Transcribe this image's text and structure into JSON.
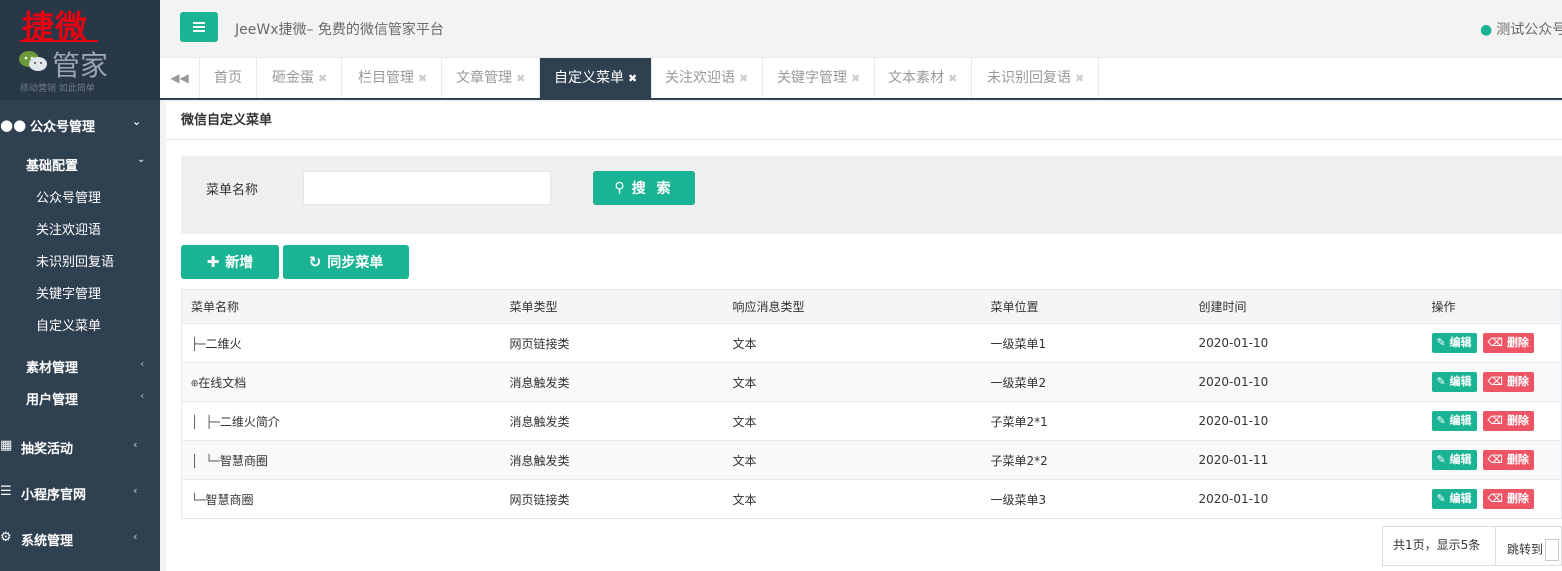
{
  "logo": {
    "main": "捷微",
    "sub": "管家",
    "slogan": "移动营销 如此简单"
  },
  "sidebar": {
    "top": {
      "label": "公众号管理"
    },
    "group": {
      "label": "基础配置"
    },
    "items": [
      "公众号管理",
      "关注欢迎语",
      "未识别回复语",
      "关键字管理",
      "自定义菜单"
    ],
    "sub_sections": [
      "素材管理",
      "用户管理"
    ],
    "sections": [
      "抽奖活动",
      "小程序官网",
      "系统管理"
    ]
  },
  "header": {
    "title": "JeeWx捷微– 免费的微信管家平台",
    "account": "测试公众号"
  },
  "tabs": [
    {
      "label": "首页",
      "closable": false
    },
    {
      "label": "砸金蛋",
      "closable": true
    },
    {
      "label": "栏目管理",
      "closable": true
    },
    {
      "label": "文章管理",
      "closable": true
    },
    {
      "label": "自定义菜单",
      "closable": true,
      "active": true
    },
    {
      "label": "关注欢迎语",
      "closable": true
    },
    {
      "label": "关键字管理",
      "closable": true
    },
    {
      "label": "文本素材",
      "closable": true
    },
    {
      "label": "未识别回复语",
      "closable": true
    }
  ],
  "panel": {
    "title": "微信自定义菜单"
  },
  "search": {
    "label": "菜单名称",
    "value": "",
    "button": "搜 索"
  },
  "actions": {
    "add": "新增",
    "sync": "同步菜单"
  },
  "table": {
    "headers": [
      "菜单名称",
      "菜单类型",
      "响应消息类型",
      "菜单位置",
      "创建时间",
      "操作"
    ],
    "rows": [
      {
        "tree": "├─",
        "name": "二维火",
        "type": "网页链接类",
        "msg": "文本",
        "pos": "一级菜单1",
        "date": "2020-01-10"
      },
      {
        "tree": "⊕",
        "name": "在线文档",
        "type": "消息触发类",
        "msg": "文本",
        "pos": "一级菜单2",
        "date": "2020-01-10"
      },
      {
        "tree": "│ ├─",
        "name": "二维火简介",
        "type": "消息触发类",
        "msg": "文本",
        "pos": "子菜单2*1",
        "date": "2020-01-10"
      },
      {
        "tree": "│ └─",
        "name": "智慧商圈",
        "type": "消息触发类",
        "msg": "文本",
        "pos": "子菜单2*2",
        "date": "2020-01-11"
      },
      {
        "tree": "└─",
        "name": "智慧商圈",
        "type": "网页链接类",
        "msg": "文本",
        "pos": "一级菜单3",
        "date": "2020-01-10"
      }
    ],
    "edit_label": "编辑",
    "delete_label": "删除"
  },
  "pager": {
    "info": "共1页，显示5条",
    "jump": "跳转到"
  },
  "colors": {
    "accent": "#1ab394",
    "danger": "#ed5565",
    "sidebar": "#2f4050",
    "brand": "#e60012"
  }
}
